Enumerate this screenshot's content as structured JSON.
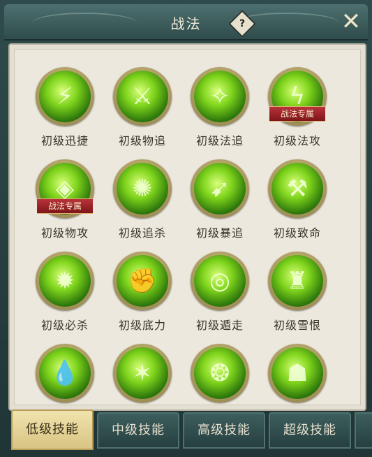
{
  "window": {
    "title": "战法"
  },
  "help_label": "?",
  "close_label": "✕",
  "skills": [
    {
      "label": "初级迅捷",
      "icon": "swift-icon",
      "glyph": "⚡",
      "badge": ""
    },
    {
      "label": "初级物追",
      "icon": "blades-icon",
      "glyph": "⚔",
      "badge": ""
    },
    {
      "label": "初级法追",
      "icon": "slash-icon",
      "glyph": "✧",
      "badge": ""
    },
    {
      "label": "初级法攻",
      "icon": "lightning-icon",
      "glyph": "ϟ",
      "badge": "战法专属"
    },
    {
      "label": "初级物攻",
      "icon": "shield-icon",
      "glyph": "◈",
      "badge": "战法专属"
    },
    {
      "label": "初级追杀",
      "icon": "whirl-icon",
      "glyph": "✺",
      "badge": ""
    },
    {
      "label": "初级暴追",
      "icon": "runner-icon",
      "glyph": "➹",
      "badge": ""
    },
    {
      "label": "初级致命",
      "icon": "axe-icon",
      "glyph": "⚒",
      "badge": ""
    },
    {
      "label": "初级必杀",
      "icon": "burst-icon",
      "glyph": "✹",
      "badge": ""
    },
    {
      "label": "初级底力",
      "icon": "fist-icon",
      "glyph": "✊",
      "badge": ""
    },
    {
      "label": "初级遁走",
      "icon": "vortex-icon",
      "glyph": "◎",
      "badge": ""
    },
    {
      "label": "初级雪恨",
      "icon": "warrior-icon",
      "glyph": "♜",
      "badge": ""
    },
    {
      "label": "",
      "icon": "droplet-icon",
      "glyph": "💧",
      "badge": ""
    },
    {
      "label": "",
      "icon": "rays-icon",
      "glyph": "✶",
      "badge": ""
    },
    {
      "label": "",
      "icon": "swirl-icon",
      "glyph": "❂",
      "badge": ""
    },
    {
      "label": "",
      "icon": "figure-icon",
      "glyph": "☗",
      "badge": ""
    }
  ],
  "tabs": [
    {
      "label": "低级技能",
      "active": true
    },
    {
      "label": "中级技能",
      "active": false
    },
    {
      "label": "高级技能",
      "active": false
    },
    {
      "label": "超级技能",
      "active": false
    }
  ],
  "colors": {
    "accent": "#7fd41c",
    "badge": "#b8333a",
    "tab_active": "#e6d393"
  }
}
